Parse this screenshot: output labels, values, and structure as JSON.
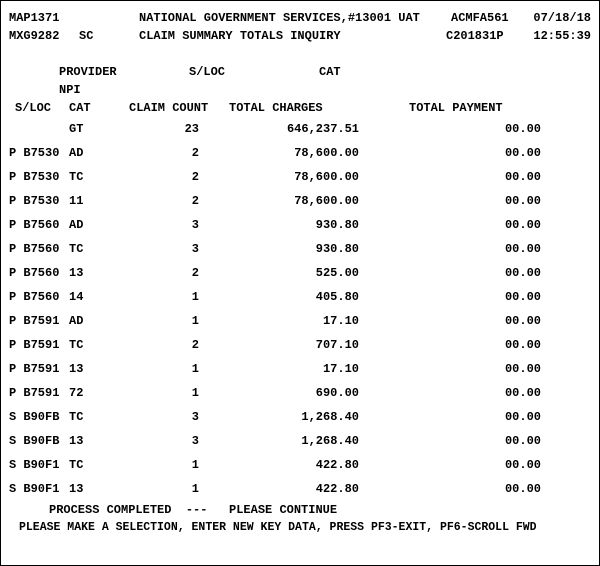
{
  "header": {
    "screen_id": "MAP1371",
    "org_title": "NATIONAL GOVERNMENT SERVICES,#13001 UAT",
    "app_id": "ACMFA561",
    "date": "07/18/18",
    "user_id": "MXG9282",
    "mode": "SC",
    "screen_title": "CLAIM SUMMARY TOTALS INQUIRY",
    "session_id": "C201831P",
    "time": "12:55:39"
  },
  "filters": {
    "provider_label": "PROVIDER",
    "sloc_label": "S/LOC",
    "cat_label": "CAT",
    "npi_label": "NPI"
  },
  "table_header": {
    "sloc": "S/LOC",
    "cat": "CAT",
    "claim_count": "CLAIM COUNT",
    "total_charges": "TOTAL CHARGES",
    "total_payment": "TOTAL PAYMENT"
  },
  "rows": [
    {
      "sloc": "",
      "cat": "GT",
      "count": "23",
      "charges": "646,237.51",
      "payment": "00.00"
    },
    {
      "sloc": "P B7530",
      "cat": "AD",
      "count": "2",
      "charges": "78,600.00",
      "payment": "00.00"
    },
    {
      "sloc": "P B7530",
      "cat": "TC",
      "count": "2",
      "charges": "78,600.00",
      "payment": "00.00"
    },
    {
      "sloc": "P B7530",
      "cat": "11",
      "count": "2",
      "charges": "78,600.00",
      "payment": "00.00"
    },
    {
      "sloc": "P B7560",
      "cat": "AD",
      "count": "3",
      "charges": "930.80",
      "payment": "00.00"
    },
    {
      "sloc": "P B7560",
      "cat": "TC",
      "count": "3",
      "charges": "930.80",
      "payment": "00.00"
    },
    {
      "sloc": "P B7560",
      "cat": "13",
      "count": "2",
      "charges": "525.00",
      "payment": "00.00"
    },
    {
      "sloc": "P B7560",
      "cat": "14",
      "count": "1",
      "charges": "405.80",
      "payment": "00.00"
    },
    {
      "sloc": "P B7591",
      "cat": "AD",
      "count": "1",
      "charges": "17.10",
      "payment": "00.00"
    },
    {
      "sloc": "P B7591",
      "cat": "TC",
      "count": "2",
      "charges": "707.10",
      "payment": "00.00"
    },
    {
      "sloc": "P B7591",
      "cat": "13",
      "count": "1",
      "charges": "17.10",
      "payment": "00.00"
    },
    {
      "sloc": "P B7591",
      "cat": "72",
      "count": "1",
      "charges": "690.00",
      "payment": "00.00"
    },
    {
      "sloc": "S B90FB",
      "cat": "TC",
      "count": "3",
      "charges": "1,268.40",
      "payment": "00.00"
    },
    {
      "sloc": "S B90FB",
      "cat": "13",
      "count": "3",
      "charges": "1,268.40",
      "payment": "00.00"
    },
    {
      "sloc": "S B90F1",
      "cat": "TC",
      "count": "1",
      "charges": "422.80",
      "payment": "00.00"
    },
    {
      "sloc": "S B90F1",
      "cat": "13",
      "count": "1",
      "charges": "422.80",
      "payment": "00.00"
    }
  ],
  "footer": {
    "line1": "PROCESS COMPLETED  ---   PLEASE CONTINUE",
    "line2": "PLEASE MAKE A SELECTION, ENTER NEW KEY DATA, PRESS PF3-EXIT, PF6-SCROLL FWD"
  }
}
